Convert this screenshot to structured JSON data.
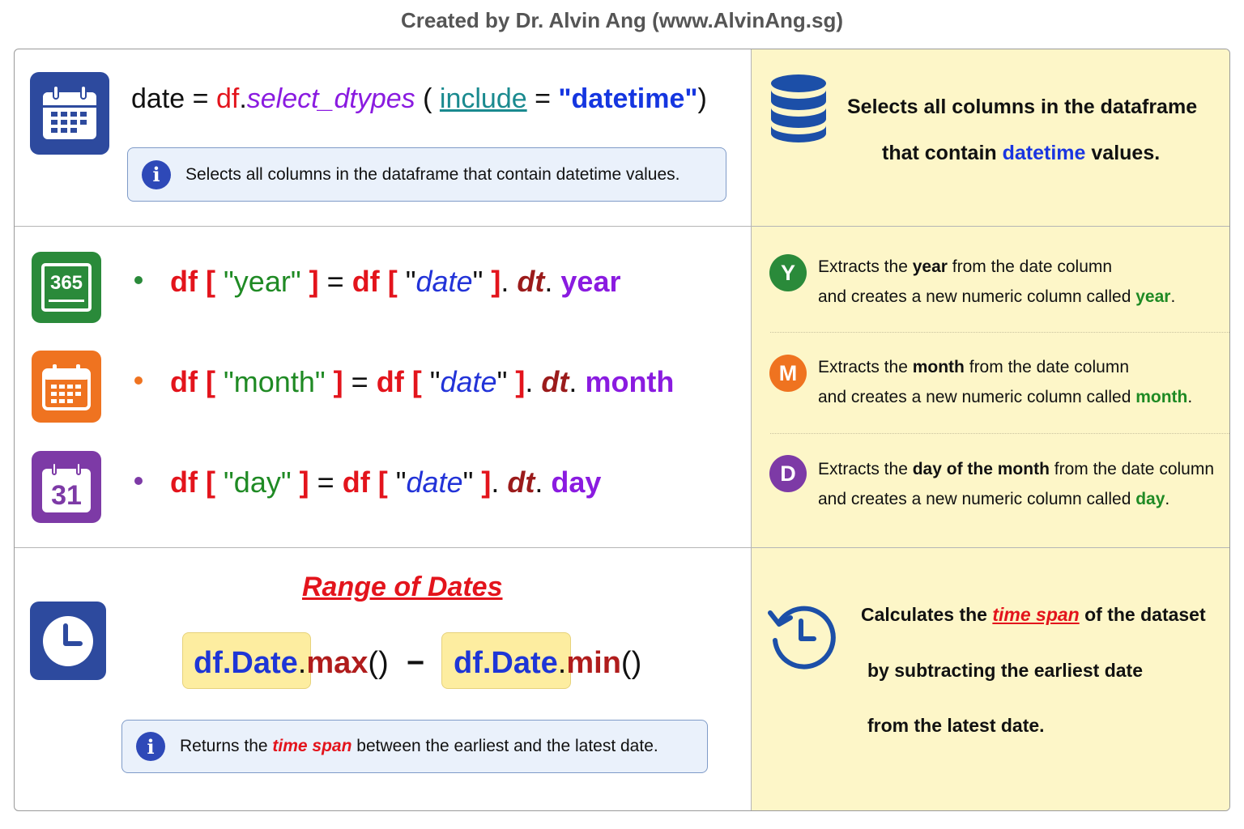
{
  "credit": "Created by Dr. Alvin Ang (www.AlvinAng.sg)",
  "section1": {
    "code": {
      "var": "date",
      "eq": "=",
      "df": "df",
      "dot": ".",
      "method": "select_dtypes",
      "open": "(",
      "param": "include",
      "eq2": "=",
      "value": "\"datetime\"",
      "close": ")"
    },
    "info_text": "Selects all columns in the dataframe that contain datetime values.",
    "right_line1": "Selects all columns in the dataframe",
    "right_line2_before": "that contain",
    "right_line2_highlight": "datetime",
    "right_line2_after": "values."
  },
  "icons": {
    "cal_365_label": "365",
    "cal_31_label": "31",
    "info_glyph": "i"
  },
  "colors": {
    "icon_blue": "#2d4a9e",
    "icon_green": "#2a8a3a",
    "icon_orange": "#ef7320",
    "icon_purple": "#7d3aa6",
    "right_panel_bg": "#fdf6c8",
    "code_red": "#e3141c"
  },
  "extract": {
    "rows": [
      {
        "key": "year",
        "badge": "Y",
        "code": {
          "df1": "df",
          "ob1": "[",
          "col": "\"year\"",
          "cb1": "]",
          "eq": "=",
          "df2": "df",
          "ob2": "[",
          "q1": "\"",
          "date": "date",
          "q2": "\"",
          "cb2": "]",
          "dot1": ".",
          "dt": "dt",
          "dot2": ".",
          "attr": "year"
        },
        "line1_before": "Extracts the",
        "line1_bold": "year",
        "line1_after": "from the date column",
        "line2_before": "and creates a new numeric column called",
        "line2_highlight": "year",
        "line2_after": "."
      },
      {
        "key": "month",
        "badge": "M",
        "code": {
          "df1": "df",
          "ob1": "[",
          "col": "\"month\"",
          "cb1": "]",
          "eq": "=",
          "df2": "df",
          "ob2": "[",
          "q1": "\"",
          "date": "date",
          "q2": "\"",
          "cb2": "]",
          "dot1": ".",
          "dt": "dt",
          "dot2": ".",
          "attr": "month"
        },
        "line1_before": "Extracts the",
        "line1_bold": "month",
        "line1_after": "from the date column",
        "line2_before": "and creates a new numeric column called",
        "line2_highlight": "month",
        "line2_after": "."
      },
      {
        "key": "day",
        "badge": "D",
        "code": {
          "df1": "df",
          "ob1": "[",
          "col": "\"day\"",
          "cb1": "]",
          "eq": "=",
          "df2": "df",
          "ob2": "[",
          "q1": "\"",
          "date": "date",
          "q2": "\"",
          "cb2": "]",
          "dot1": ".",
          "dt": "dt",
          "dot2": ".",
          "attr": "day"
        },
        "line1_before": "Extracts the",
        "line1_bold": "day of the month",
        "line1_after": "from the date column",
        "line2_before": "and creates a new numeric column called",
        "line2_highlight": "day",
        "line2_after": "."
      }
    ]
  },
  "range": {
    "title": "Range of Dates",
    "max_obj": "df.Date",
    "max_dot": ".",
    "max_fn": "max",
    "max_paren": "()",
    "minus": "−",
    "min_obj": "df.Date",
    "min_dot": ".",
    "min_fn": "min",
    "min_paren": "()",
    "info_before": "Returns the",
    "info_highlight": "time span",
    "info_after": "between the earliest and the latest date.",
    "right_line1_before": "Calculates the",
    "right_line1_highlight": "time span",
    "right_line1_after": "of the dataset",
    "right_line2": "by subtracting the earliest date",
    "right_line3": "from the latest date."
  }
}
